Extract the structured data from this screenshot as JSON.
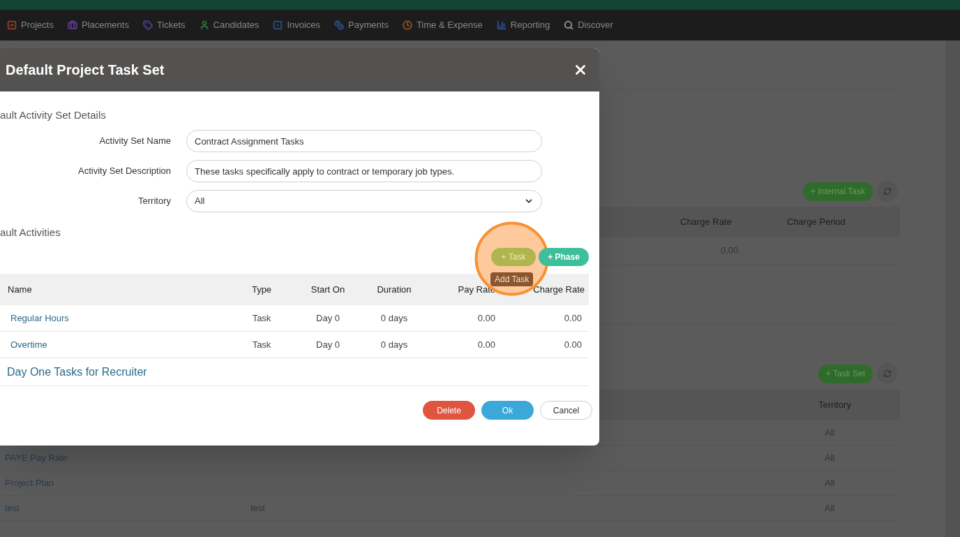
{
  "nav": [
    {
      "label": "Projects",
      "color": "#8a3a2a"
    },
    {
      "label": "Placements",
      "color": "#5a3a8a"
    },
    {
      "label": "Tickets",
      "color": "#4a3a8a"
    },
    {
      "label": "Candidates",
      "color": "#2a6a3a"
    },
    {
      "label": "Invoices",
      "color": "#2a4a7a"
    },
    {
      "label": "Payments",
      "color": "#2a4a8a"
    },
    {
      "label": "Time & Expense",
      "color": "#8a4a1a"
    },
    {
      "label": "Reporting",
      "color": "#2a4a8a"
    },
    {
      "label": "Discover",
      "color": "#8a8a8a"
    }
  ],
  "background": {
    "internal_tasks": {
      "add_button": "+ Internal Task",
      "columns": [
        "Charge Rate",
        "Charge Period"
      ],
      "rows": [
        {
          "charge_rate": "0.00"
        }
      ]
    },
    "task_sets": {
      "add_button": "+ Task Set",
      "columns": [
        "Territory"
      ],
      "rows": [
        {
          "name": "",
          "column_2": "",
          "territory": "All"
        },
        {
          "name": "PAYE Pay Rate",
          "column_2": "",
          "territory": "All"
        },
        {
          "name": "Project Plan",
          "column_2": "",
          "territory": "All"
        },
        {
          "name": "test",
          "column_2": "test",
          "territory": "All"
        }
      ]
    }
  },
  "dialog": {
    "title": "Default Project Task Set",
    "details_heading": "ault Activity Set Details",
    "fields": [
      {
        "kind": "text",
        "label": "Activity Set Name",
        "value": "Contract Assignment Tasks"
      },
      {
        "kind": "text",
        "label": "Activity Set Description",
        "value": "These tasks specifically apply to contract or temporary job types."
      },
      {
        "kind": "select",
        "label": "Territory",
        "value": "All"
      }
    ],
    "activities_heading": "ault Activities",
    "task_button": "+ Task",
    "phase_button": "+ Phase",
    "tooltip": "Add Task",
    "columns": [
      "Name",
      "Type",
      "Start On",
      "Duration",
      "Pay Rate",
      "Charge Rate"
    ],
    "rows": [
      {
        "name": "Regular Hours",
        "type": "Task",
        "start_on": "Day 0",
        "duration": "0 days",
        "pay_rate": "0.00",
        "charge_rate": "0.00"
      },
      {
        "name": "Overtime",
        "type": "Task",
        "start_on": "Day 0",
        "duration": "0 days",
        "pay_rate": "0.00",
        "charge_rate": "0.00"
      }
    ],
    "group": "Day One Tasks for Recruiter",
    "buttons": {
      "delete": "Delete",
      "ok": "Ok",
      "cancel": "Cancel"
    }
  }
}
